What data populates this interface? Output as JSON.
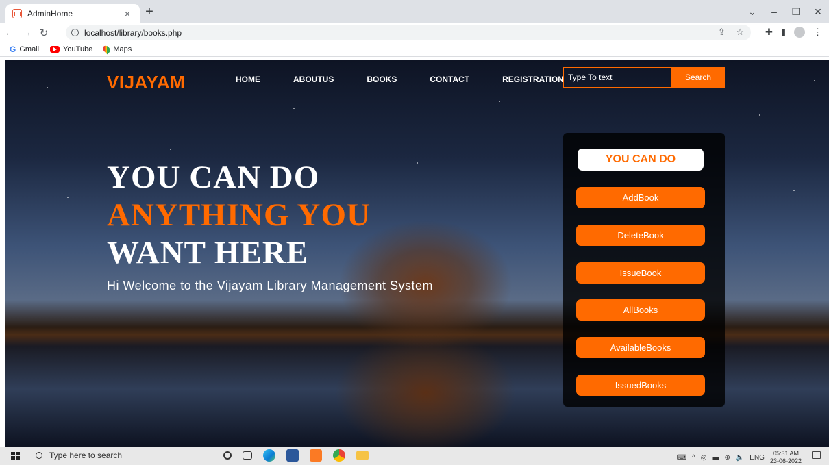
{
  "browser": {
    "tab_title": "AdminHome",
    "tab_close": "×",
    "new_tab": "+",
    "url": "localhost/library/books.php",
    "bookmarks": [
      {
        "label": "Gmail",
        "icon": "gmail-icon"
      },
      {
        "label": "YouTube",
        "icon": "youtube-icon"
      },
      {
        "label": "Maps",
        "icon": "maps-icon"
      }
    ]
  },
  "site": {
    "logo": "VIJAYAM",
    "nav": [
      "HOME",
      "ABOUTUS",
      "BOOKS",
      "CONTACT",
      "REGISTRATION"
    ],
    "search": {
      "placeholder": "Type To text",
      "button": "Search"
    },
    "hero": {
      "line1": "YOU CAN DO",
      "line2": "ANYTHING YOU",
      "line3": "WANT HERE"
    },
    "welcome": "Hi Welcome to the Vijayam Library Management System",
    "panel": {
      "title": "YOU CAN DO",
      "buttons": [
        "AddBook",
        "DeleteBook",
        "IssueBook",
        "AllBooks",
        "AvailableBooks",
        "IssuedBooks"
      ]
    },
    "accent_color": "#ff6a00"
  },
  "taskbar": {
    "search_placeholder": "Type here to search",
    "language": "ENG",
    "time": "05:31 AM",
    "date": "23-06-2022"
  }
}
